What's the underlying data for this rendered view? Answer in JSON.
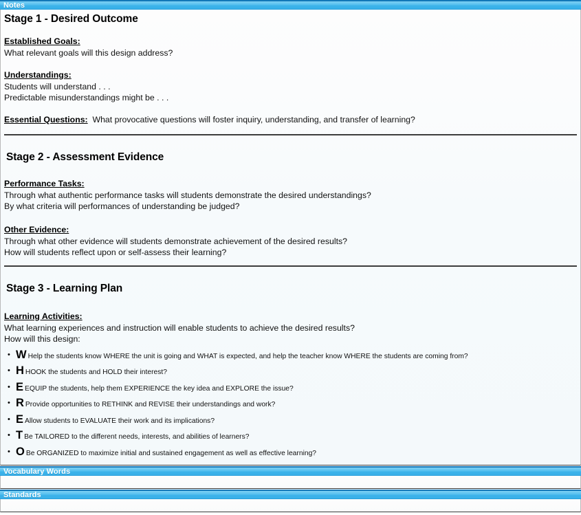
{
  "panels": {
    "notes": {
      "title": "Notes"
    },
    "vocabulary": {
      "title": "Vocabulary Words"
    },
    "standards": {
      "title": "Standards"
    }
  },
  "notes": {
    "stage1": {
      "title": "Stage 1 - Desired Outcome",
      "established_goals": {
        "label": "Established Goals: ",
        "lines": [
          "What relevant goals will this design address?"
        ]
      },
      "understandings": {
        "label": "Understandings:",
        "lines": [
          "Students will understand . . .",
          "Predictable misunderstandings might be . . ."
        ]
      },
      "essential_questions": {
        "label": "Essential Questions:",
        "text": "What provocative questions will foster inquiry, understanding, and transfer of learning?"
      }
    },
    "stage2": {
      "title": "Stage 2 - Assessment Evidence",
      "performance_tasks": {
        "label": "Performance Tasks:",
        "lines": [
          "Through what authentic performance tasks will students demonstrate the desired understandings?",
          "By what criteria will performances of understanding be judged?"
        ]
      },
      "other_evidence": {
        "label": "Other Evidence:",
        "lines": [
          "Through what other evidence will students demonstrate achievement of the desired results?",
          "How will students reflect upon or self-assess their learning?"
        ]
      }
    },
    "stage3": {
      "title": "Stage 3 - Learning Plan",
      "learning_activities": {
        "label": "Learning Activities:",
        "lines": [
          "What learning experiences and instruction will enable students to achieve the desired results?",
          "How will this design:"
        ]
      },
      "whereto": [
        {
          "bullet": "•",
          "letter": "W",
          "detail": "Help the students know WHERE the unit is going and WHAT is expected, and help the teacher know WHERE the students are coming from?"
        },
        {
          "bullet": "•",
          "letter": "H",
          "detail": "HOOK the students and HOLD their interest?"
        },
        {
          "bullet": "•",
          "letter": "E",
          "detail": "EQUIP the students, help them EXPERIENCE the key idea and EXPLORE the issue?"
        },
        {
          "bullet": "•",
          "letter": "R",
          "detail": "Provide opportunities to RETHINK and REVISE their understandings and work?"
        },
        {
          "bullet": "•",
          "letter": "E",
          "detail": "Allow students to EVALUATE their work and its implications?"
        },
        {
          "bullet": "•",
          "letter": "T",
          "detail": "Be TAILORED to the different needs, interests, and abilities of learners?"
        },
        {
          "bullet": "•",
          "letter": "O",
          "detail": "Be ORGANIZED to maximize initial and sustained engagement as well as effective learning?"
        }
      ]
    }
  },
  "colors": {
    "bar_blue": "#3bb2ea",
    "bar_blue_light": "#7fd0f4",
    "bar_border_top": "#1277b8",
    "bar_text": "#ffffff",
    "panel_bg": "#f6fafc",
    "rule": "#3c3c3c",
    "panel_border": "#b9b9b9"
  }
}
